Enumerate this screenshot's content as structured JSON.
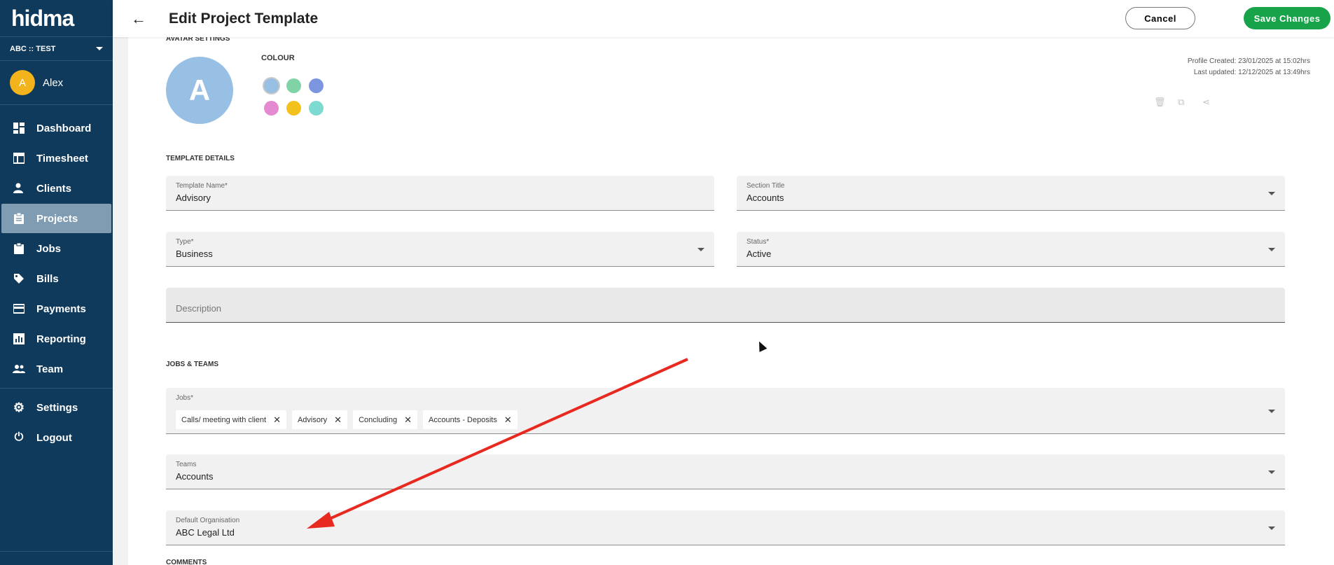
{
  "sidebar": {
    "logo": "hidma",
    "org": "ABC :: TEST",
    "user": {
      "initial": "A",
      "name": "Alex"
    },
    "items": [
      {
        "label": "Dashboard",
        "icon": "dashboard-icon"
      },
      {
        "label": "Timesheet",
        "icon": "table-icon"
      },
      {
        "label": "Clients",
        "icon": "person-icon"
      },
      {
        "label": "Projects",
        "icon": "clipboard-icon",
        "active": true
      },
      {
        "label": "Jobs",
        "icon": "clipboard-check-icon"
      },
      {
        "label": "Bills",
        "icon": "tag-icon"
      },
      {
        "label": "Payments",
        "icon": "credit-card-icon"
      },
      {
        "label": "Reporting",
        "icon": "bar-chart-icon"
      },
      {
        "label": "Team",
        "icon": "people-icon"
      }
    ],
    "settings_label": "Settings",
    "logout_label": "Logout"
  },
  "header": {
    "title": "Edit Project Template",
    "cancel_label": "Cancel",
    "save_label": "Save Changes"
  },
  "avatar": {
    "section_label": "AVATAR SETTINGS",
    "initial": "A",
    "colour_label": "COLOUR",
    "colours": [
      "#98c0e4",
      "#7fd3a6",
      "#7b95de",
      "#e48ad0",
      "#f2c11c",
      "#7ddad0"
    ],
    "selected_colour": "#98c0e4"
  },
  "meta": {
    "created": "Profile Created: 23/01/2025 at 15:02hrs",
    "updated": "Last updated: 12/12/2025 at 13:49hrs"
  },
  "template_details": {
    "section_label": "TEMPLATE DETAILS",
    "template_name": {
      "label": "Template Name*",
      "value": "Advisory"
    },
    "section_title": {
      "label": "Section Title",
      "value": "Accounts"
    },
    "type": {
      "label": "Type*",
      "value": "Business"
    },
    "status": {
      "label": "Status*",
      "value": "Active"
    },
    "description": {
      "placeholder": "Description"
    }
  },
  "jobs_teams": {
    "section_label": "JOBS & TEAMS",
    "jobs_label": "Jobs*",
    "jobs": [
      "Calls/ meeting with client",
      "Advisory",
      "Concluding",
      "Accounts - Deposits"
    ],
    "teams": {
      "label": "Teams",
      "value": "Accounts"
    },
    "default_org": {
      "label": "Default Organisation",
      "value": "ABC Legal Ltd"
    }
  },
  "comments": {
    "section_label": "COMMENTS"
  },
  "colors": {
    "sidebar": "#0f3a5b",
    "accent": "#18a34a",
    "annotation": "#e8291f"
  }
}
